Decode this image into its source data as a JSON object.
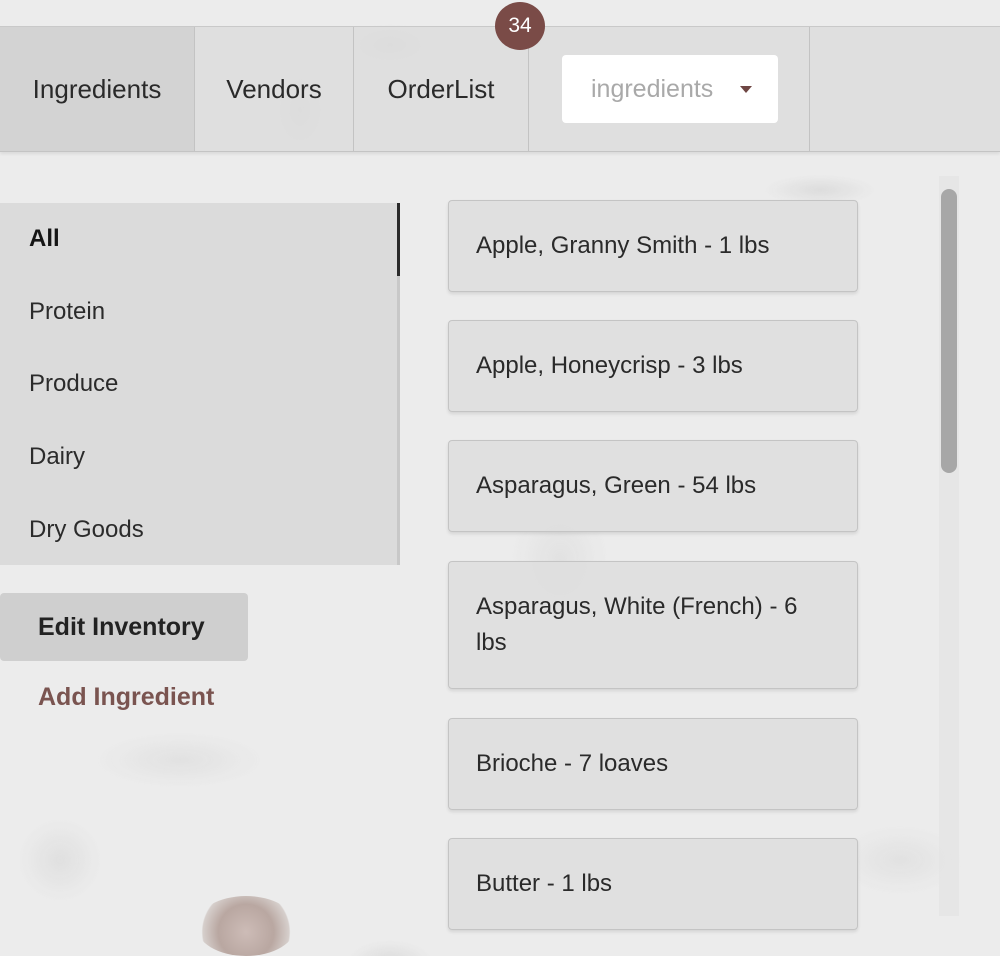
{
  "nav": {
    "tabs": [
      {
        "label": "Ingredients",
        "active": true
      },
      {
        "label": "Vendors",
        "active": false
      },
      {
        "label": "OrderList",
        "active": false
      }
    ],
    "order_badge": "34",
    "select": {
      "value": "ingredients"
    }
  },
  "categories": [
    {
      "label": "All",
      "active": true
    },
    {
      "label": "Protein",
      "active": false
    },
    {
      "label": "Produce",
      "active": false
    },
    {
      "label": "Dairy",
      "active": false
    },
    {
      "label": "Dry Goods",
      "active": false
    }
  ],
  "actions": {
    "edit_inventory": "Edit Inventory",
    "add_ingredient": "Add Ingredient"
  },
  "ingredients": [
    {
      "text": "Apple, Granny Smith - 1 lbs"
    },
    {
      "text": "Apple, Honeycrisp - 3 lbs"
    },
    {
      "text": "Asparagus, Green - 54 lbs"
    },
    {
      "text": "Asparagus, White (French) - 6 lbs"
    },
    {
      "text": "Brioche - 7 loaves"
    },
    {
      "text": "Butter - 1 lbs"
    }
  ],
  "colors": {
    "accent": "#7a4b47",
    "link": "#7a5450"
  }
}
